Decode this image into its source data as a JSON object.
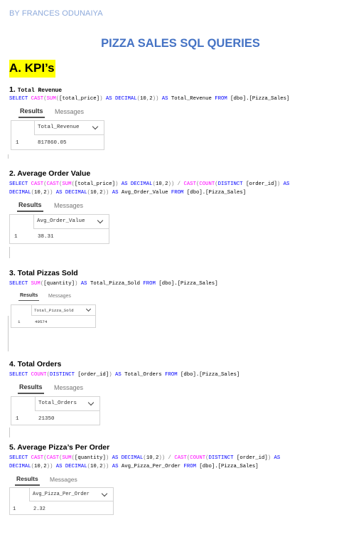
{
  "author": "BY FRANCES ODUNAIYA",
  "title": "PIZZA SALES SQL QUERIES",
  "section": "A. KPI’s",
  "tab_results": "Results",
  "tab_messages": "Messages",
  "row_number": "1",
  "queries": [
    {
      "heading_num": "1.",
      "heading": "Total Revenue",
      "sql": [
        "SELECT CAST(SUM([total_price]) AS DECIMAL(10,2)) AS Total_Revenue FROM [dbo].[Pizza_Sales]"
      ],
      "column": "Total_Revenue",
      "value": "817860.05"
    },
    {
      "heading": "2. Average Order Value",
      "sql": [
        "SELECT CAST(CAST(SUM([total_price]) AS DECIMAL(10,2)) / CAST(COUNT(DISTINCT [order_id]) AS",
        "DECIMAL(10,2)) AS DECIMAL(10,2)) AS Avg_Order_Value FROM [dbo].[Pizza_Sales]"
      ],
      "column": "Avg_Order_Value",
      "value": "38.31"
    },
    {
      "heading": "3. Total Pizzas Sold",
      "sql": [
        "SELECT SUM([quantity]) AS Total_Pizza_Sold FROM [dbo].[Pizza_Sales]"
      ],
      "column": "Total_Pizza_Sold",
      "value": "49574"
    },
    {
      "heading": "4. Total Orders",
      "sql": [
        "SELECT COUNT(DISTINCT [order_id]) AS Total_Orders FROM [dbo].[Pizza_Sales]"
      ],
      "column": "Total_Orders",
      "value": "21350"
    },
    {
      "heading": "5. Average Pizza’s Per Order",
      "sql": [
        "SELECT CAST(CAST(SUM([quantity]) AS DECIMAL(10,2)) / CAST(COUNT(DISTINCT [order_id]) AS",
        "DECIMAL(10,2)) AS DECIMAL(10,2)) AS Avg_Pizza_Per_Order FROM [dbo].[Pizza_Sales]"
      ],
      "column": "Avg_Pizza_Per_Order",
      "value": "2.32"
    }
  ]
}
